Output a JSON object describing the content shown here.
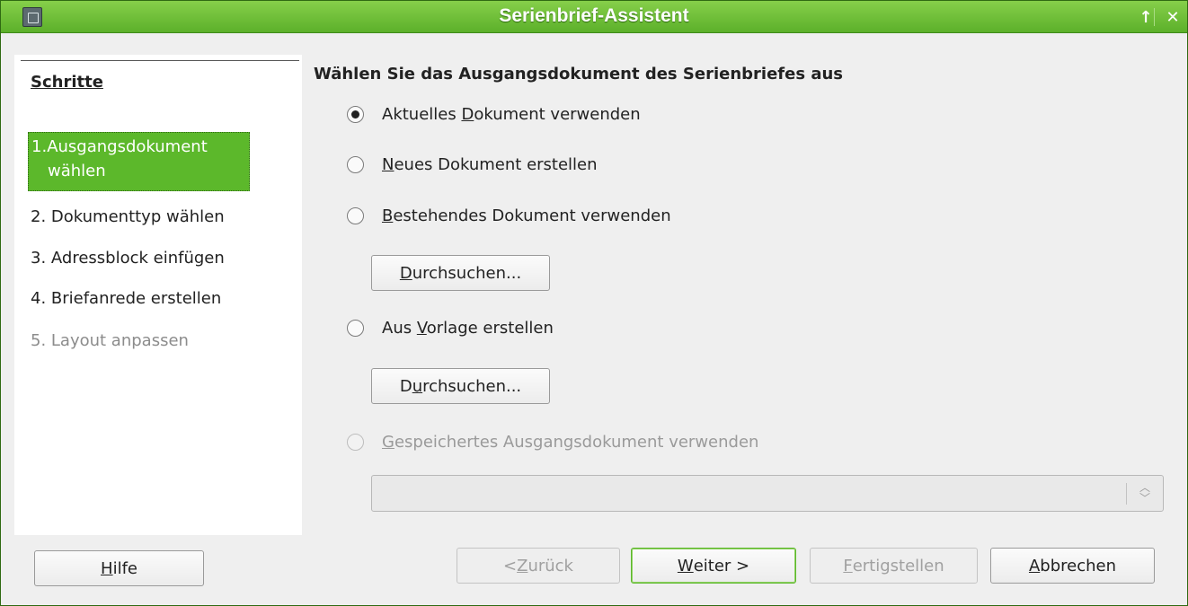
{
  "window": {
    "title": "Serienbrief-Assistent",
    "up_icon": "↑",
    "close_icon": "✕"
  },
  "steps": {
    "title": "Schritte",
    "items": [
      {
        "num": "1.",
        "label_line1": "Ausgangsdokument",
        "label_line2": "wählen",
        "state": "active"
      },
      {
        "label": "2. Dokumenttyp wählen",
        "state": "enabled"
      },
      {
        "label": "3. Adressblock einfügen",
        "state": "enabled"
      },
      {
        "label": "4. Briefanrede erstellen",
        "state": "enabled"
      },
      {
        "label": "5. Layout anpassen",
        "state": "disabled"
      }
    ]
  },
  "main": {
    "heading": "Wählen Sie das Ausgangsdokument des Serienbriefes aus",
    "options": [
      {
        "pre": "Aktuelles ",
        "mn": "D",
        "post": "okument verwenden",
        "checked": true,
        "enabled": true
      },
      {
        "pre": "",
        "mn": "N",
        "post": "eues Dokument erstellen",
        "checked": false,
        "enabled": true
      },
      {
        "pre": "",
        "mn": "B",
        "post": "estehendes Dokument verwenden",
        "checked": false,
        "enabled": true
      },
      {
        "pre": "Aus ",
        "mn": "V",
        "post": "orlage erstellen",
        "checked": false,
        "enabled": true
      },
      {
        "pre": "",
        "mn": "G",
        "post": "espeichertes Ausgangsdokument verwenden",
        "checked": false,
        "enabled": false
      }
    ],
    "browse1": {
      "pre": "",
      "mn": "D",
      "post": "urchsuchen..."
    },
    "browse2": {
      "pre": "D",
      "mn": "u",
      "post": "rchsuchen..."
    },
    "saved_doc_combo": {
      "value": "",
      "enabled": false
    }
  },
  "footer": {
    "help": {
      "pre": "",
      "mn": "H",
      "post": "ilfe"
    },
    "back": {
      "pre": "< ",
      "mn": "Z",
      "post": "urück",
      "enabled": false
    },
    "next": {
      "pre": "",
      "mn": "W",
      "post": "eiter >",
      "enabled": true
    },
    "finish": {
      "pre": "",
      "mn": "F",
      "post": "ertigstellen",
      "enabled": false
    },
    "cancel": {
      "pre": "",
      "mn": "A",
      "post": "bbrechen",
      "enabled": true
    }
  },
  "colors": {
    "accent": "#5cb82b",
    "titlebar": "#6cbd38"
  }
}
